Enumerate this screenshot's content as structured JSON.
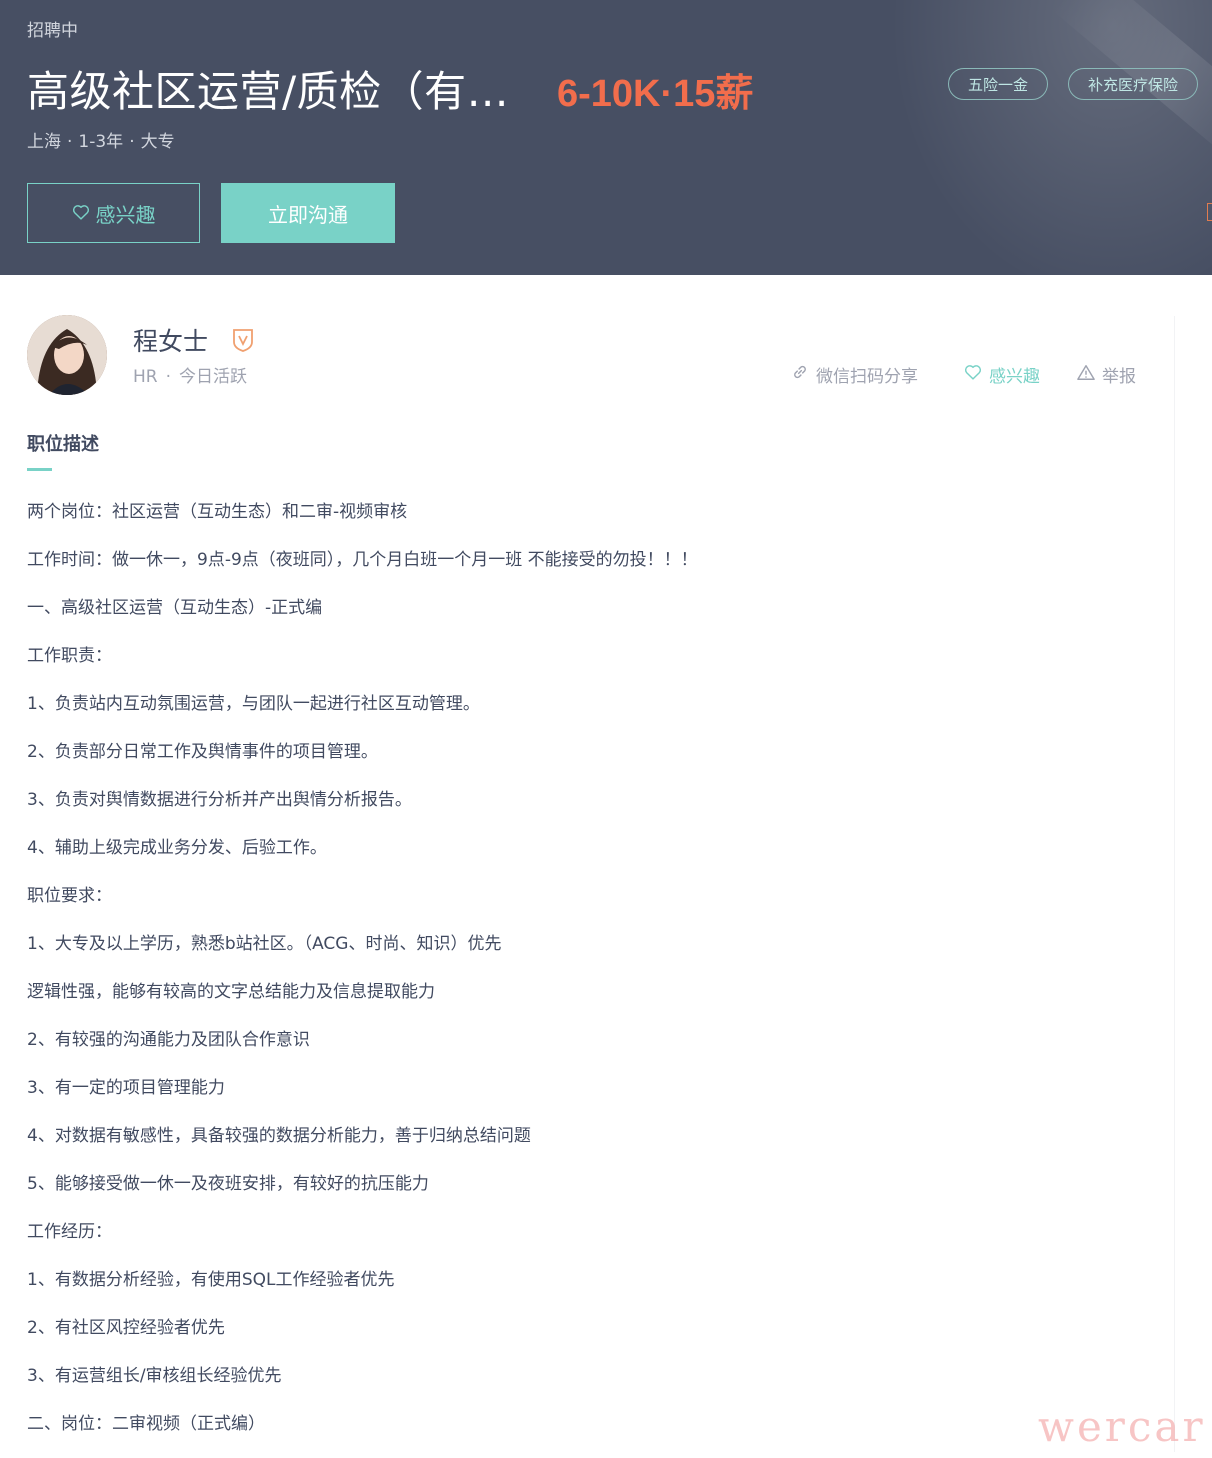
{
  "header": {
    "status": "招聘中",
    "title": "高级社区运营/质检（有…",
    "salary": "6-10K·15薪",
    "location": "上海",
    "experience": "1-3年",
    "education": "大专",
    "tags": [
      "五险一金",
      "补充医疗保险"
    ],
    "interest_button": "感兴趣",
    "chat_button": "立即沟通"
  },
  "recruiter": {
    "name": "程女士",
    "role": "HR",
    "activity": "今日活跃"
  },
  "actions": {
    "share": "微信扫码分享",
    "interest": "感兴趣",
    "report": "举报"
  },
  "description": {
    "title": "职位描述",
    "lines": [
      "两个岗位：社区运营（互动生态）和二审-视频审核",
      "工作时间：做一休一，9点-9点（夜班同），几个月白班一个月一班 不能接受的勿投！！！",
      "一、高级社区运营（互动生态）-正式编",
      "工作职责：",
      "1、负责站内互动氛围运营，与团队一起进行社区互动管理。",
      "2、负责部分日常工作及舆情事件的项目管理。",
      "3、负责对舆情数据进行分析并产出舆情分析报告。",
      "4、辅助上级完成业务分发、后验工作。",
      "职位要求：",
      "1、大专及以上学历，熟悉b站社区。（ACG、时尚、知识）优先",
      "逻辑性强，能够有较高的文字总结能力及信息提取能力",
      "2、有较强的沟通能力及团队合作意识",
      "3、有一定的项目管理能力",
      "4、对数据有敏感性，具备较强的数据分析能力，善于归纳总结问题",
      "5、能够接受做一休一及夜班安排，有较好的抗压能力",
      "工作经历：",
      "1、有数据分析经验，有使用SQL工作经验者优先",
      "2、有社区风控经验者优先",
      "3、有运营组长/审核组长经验优先",
      "二、岗位：二审视频（正式编）"
    ]
  },
  "watermark": "wercar",
  "colors": {
    "banner_bg": "#474f63",
    "accent_teal": "#79d2c7",
    "salary_orange": "#f26d4c",
    "text_dark": "#414a60",
    "text_muted": "#9fa3b0"
  }
}
